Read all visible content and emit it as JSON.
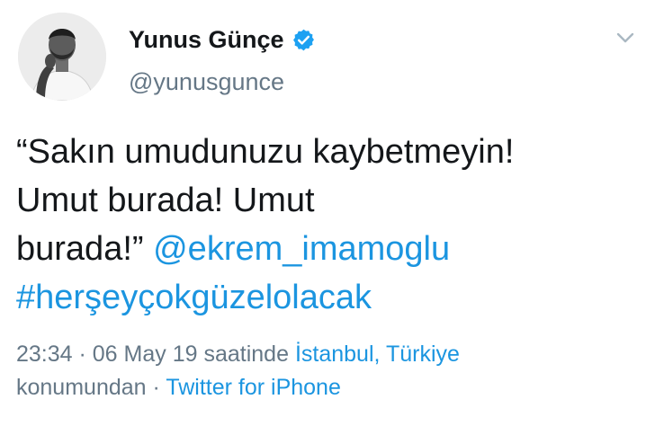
{
  "author": {
    "display_name": "Yunus Günçe",
    "handle": "@yunusgunce",
    "verified": true
  },
  "tweet": {
    "text_line1": "“Sakın umudunuzu kaybetmeyin!",
    "text_line2": "Umut burada! Umut",
    "text_line3_plain": "burada!”",
    "mention": "@ekrem_imamoglu",
    "hashtag": "#herşeyçokgüzelolacak"
  },
  "meta": {
    "time": "23:34",
    "date_text": " · 06 May 19 saatinde ",
    "location": "İstanbul, Türkiye",
    "location_suffix": "konumundan · ",
    "client": "Twitter for iPhone"
  },
  "icons": {
    "verified": "verified-badge-icon",
    "more": "chevron-down-icon"
  },
  "colors": {
    "link": "#1b95e0",
    "secondary": "#657786",
    "text": "#14171a"
  }
}
